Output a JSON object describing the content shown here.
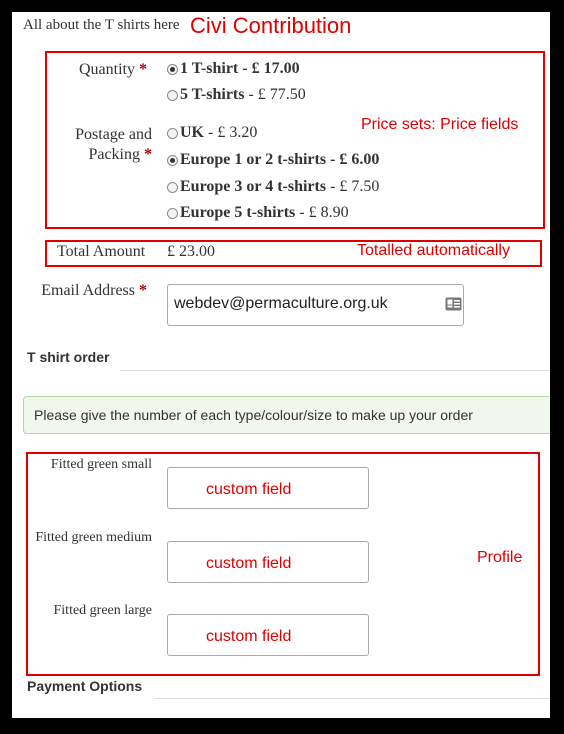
{
  "header": {
    "intro": "All about the T shirts here",
    "title_annotation": "Civi Contribution"
  },
  "price_sets": {
    "annotation": "Price sets: Price fields",
    "quantity": {
      "label": "Quantity",
      "required": "*",
      "options": [
        {
          "name": "1 T-shirt",
          "price": "- £ 17.00",
          "selected": true
        },
        {
          "name": "5 T-shirts",
          "price": "- £ 77.50",
          "selected": false
        }
      ]
    },
    "postage": {
      "label_line1": "Postage and",
      "label_line2": "Packing",
      "required": "*",
      "options": [
        {
          "name": "UK",
          "price": "- £ 3.20",
          "selected": false
        },
        {
          "name": "Europe 1 or 2 t-shirts",
          "price": "- £ 6.00",
          "selected": true
        },
        {
          "name": "Europe 3 or 4 t-shirts",
          "price": "- £ 7.50",
          "selected": false
        },
        {
          "name": "Europe 5 t-shirts",
          "price": "- £ 8.90",
          "selected": false
        }
      ]
    }
  },
  "total": {
    "label": "Total Amount",
    "value": "£ 23.00",
    "annotation": "Totalled automatically"
  },
  "email": {
    "label": "Email Address",
    "required": "*",
    "value": "webdev@permaculture.org.uk",
    "icon": "contact-card-icon"
  },
  "tshirt_order": {
    "heading": "T shirt order",
    "notice": "Please give the number of each type/colour/size to make up your order"
  },
  "profile": {
    "annotation": "Profile",
    "fields": [
      {
        "label": "Fitted green small",
        "placeholder": "custom field"
      },
      {
        "label": "Fitted green medium",
        "placeholder": "custom field"
      },
      {
        "label": "Fitted green large",
        "placeholder": "custom field"
      }
    ]
  },
  "payment": {
    "heading": "Payment Options"
  },
  "colors": {
    "annotation_red": "#e00000",
    "required_red": "#aa0000",
    "notice_bg": "#f1f8eb",
    "notice_border": "#b4d7a0",
    "page_bg": "#000000"
  }
}
